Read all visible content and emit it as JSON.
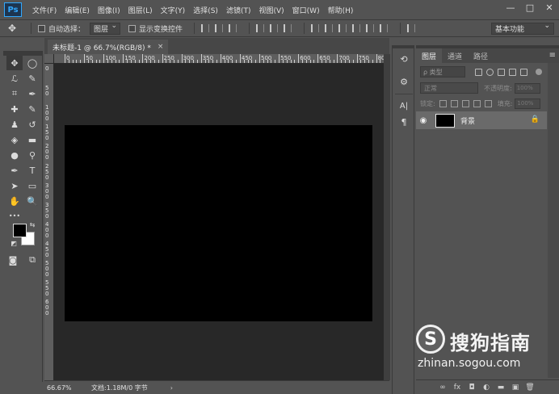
{
  "app": {
    "logo": "Ps"
  },
  "menu": [
    "文件(F)",
    "编辑(E)",
    "图像(I)",
    "图层(L)",
    "文字(Y)",
    "选择(S)",
    "滤镜(T)",
    "视图(V)",
    "窗口(W)",
    "帮助(H)"
  ],
  "window_controls": {
    "minimize": "—",
    "maximize": "□",
    "close": "✕"
  },
  "options_bar": {
    "tool_icon": "move-icon",
    "auto_select_label": "自动选择：",
    "auto_select_value": "图层",
    "show_transform_label": "显示变换控件",
    "workspace": "基本功能"
  },
  "document": {
    "tab_title": "未标题-1 @ 66.7%(RGB/8) *",
    "tab_close": "×",
    "canvas_color": "#000000",
    "ruler_h_labels": [
      "0",
      "50",
      "100",
      "150",
      "200",
      "250",
      "300",
      "350",
      "400",
      "450",
      "500",
      "550",
      "600",
      "650",
      "700",
      "750",
      "800"
    ],
    "ruler_v_labels": [
      "0",
      "50",
      "100",
      "150",
      "200",
      "250",
      "300",
      "350",
      "400",
      "450",
      "500",
      "550",
      "600"
    ]
  },
  "status": {
    "zoom": "66.67%",
    "doc_info": "文档:1.18M/0 字节",
    "arrow": "›"
  },
  "tools": {
    "move": "✥",
    "marquee": "◯",
    "lasso": "ℒ",
    "quick_select": "✎",
    "crop": "⌗",
    "eyedropper": "✒",
    "heal": "✚",
    "brush": "✎",
    "stamp": "♟",
    "history_brush": "↺",
    "eraser": "◈",
    "gradient": "▬",
    "blur": "●",
    "dodge": "⚲",
    "pen": "✒",
    "type": "T",
    "path_select": "➤",
    "shape": "▭",
    "hand": "✋",
    "zoom": "🔍",
    "more": "•••",
    "swap": "⇆",
    "reset": "◩",
    "quick_mask": "◙",
    "screen_mode": "⧉"
  },
  "dock": {
    "history": "⟲",
    "properties": "⚙",
    "character": "A|",
    "paragraph": "¶"
  },
  "layers_panel": {
    "tabs": [
      "图层",
      "通道",
      "路径"
    ],
    "menu_icon": "≡",
    "filter_placeholder": "ρ 类型",
    "blend_mode": "正常",
    "opacity_label": "不透明度:",
    "opacity_value": "100%",
    "lock_label": "锁定:",
    "fill_label": "填充:",
    "fill_value": "100%",
    "layers": [
      {
        "name": "背景",
        "visible": true,
        "locked": true,
        "thumb_color": "#000000"
      }
    ],
    "footer_icons": [
      "link-icon",
      "fx-icon",
      "mask-icon",
      "adjustment-icon",
      "folder-icon",
      "new-layer-icon",
      "trash-icon"
    ],
    "footer_glyphs": [
      "∞",
      "fx",
      "◘",
      "◐",
      "▬",
      "▣",
      "🗑"
    ]
  },
  "watermark": {
    "logo": "S",
    "brand": "搜狗指南",
    "url": "zhinan.sogou.com"
  }
}
